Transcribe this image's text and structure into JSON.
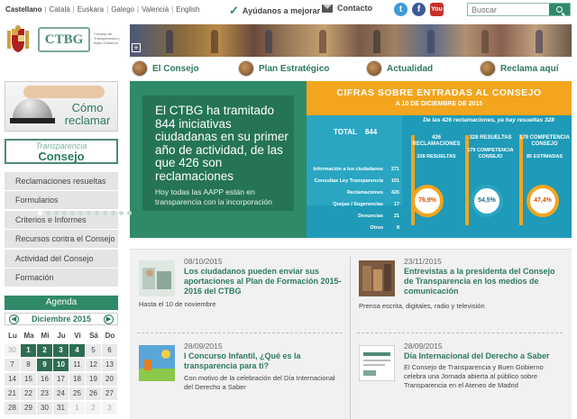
{
  "languages": [
    "Castellano",
    "Català",
    "Euskara",
    "Galego",
    "Valencià",
    "English"
  ],
  "help_link": "Ayúdanos a mejorar",
  "contact_link": "Contacto",
  "social": {
    "twitter": "t",
    "facebook": "f",
    "youtube": "You"
  },
  "search": {
    "placeholder": "Buscar"
  },
  "logo": {
    "name": "CTBG",
    "subtitle": "Consejo de Transparencia y Buen Gobierno"
  },
  "sections": [
    {
      "label": "El Consejo"
    },
    {
      "label": "Plan Estratégico"
    },
    {
      "label": "Actualidad"
    },
    {
      "label": "Reclama aquí"
    }
  ],
  "reclamar_box": "Cómo reclamar",
  "transparencia_box": {
    "line1": "Transparencia",
    "line2": "Consejo"
  },
  "side_menu": [
    "Reclamaciones resueltas",
    "Formularios",
    "Criterios e Informes",
    "Recursos contra el Consejo",
    "Actividad del Consejo",
    "Formación"
  ],
  "agenda": {
    "title": "Agenda",
    "month": "Diciembre 2015",
    "weekdays": [
      "Lu",
      "Ma",
      "Mi",
      "Ju",
      "Vi",
      "Sá",
      "Do"
    ],
    "weeks": [
      [
        "30",
        "1",
        "2",
        "3",
        "4",
        "5",
        "6"
      ],
      [
        "7",
        "8",
        "9",
        "10",
        "11",
        "12",
        "13"
      ],
      [
        "14",
        "15",
        "16",
        "17",
        "18",
        "19",
        "20"
      ],
      [
        "21",
        "22",
        "23",
        "24",
        "25",
        "26",
        "27"
      ],
      [
        "28",
        "29",
        "30",
        "31",
        "1",
        "2",
        "3"
      ]
    ]
  },
  "slider": {
    "headline": "El CTBG ha tramitado 844 iniciativas ciudadanas en su primer año de actividad, de las que 426 son reclamaciones",
    "subtext": "Hoy todas las AAPP están en transparencia con la incorporación"
  },
  "infographic": {
    "title": "CIFRAS SOBRE ENTRADAS AL CONSEJO",
    "date": "A 10 DE DICIEMBRE DE 2015",
    "total_label": "TOTAL",
    "total_value": "844",
    "stats": [
      {
        "label": "Información a los ciudadanos",
        "value": "271"
      },
      {
        "label": "Consultas Ley Transparencia",
        "value": "101"
      },
      {
        "label": "Reclamaciones",
        "value": "426"
      },
      {
        "label": "Quejas / Sugerencias",
        "value": "17"
      },
      {
        "label": "Denuncias",
        "value": "21"
      },
      {
        "label": "Otros",
        "value": "8"
      }
    ],
    "summary_heading": "De las 426 reclamaciones, ya hay resueltas 328",
    "columns": [
      {
        "top": "426 RECLAMACIONES",
        "mid": "328 RESUELTAS"
      },
      {
        "top": "328 RESUELTAS",
        "mid": "179 COMPETENCIA CONSEJO"
      },
      {
        "top": "179 COMPETENCIA CONSEJO",
        "mid": "85 ESTIMADAS"
      }
    ],
    "pies": [
      "76,9%",
      "54,5%",
      "47,4%"
    ]
  },
  "news": [
    {
      "date": "08/10/2015",
      "title": "Los ciudadanos pueden enviar sus aportaciones al Plan de Formación 2015-2016 del CTBG",
      "desc": "Hasta el 10 de noviembre"
    },
    {
      "date": "23/11/2015",
      "title": "Entrevistas a la presidenta del Consejo de Transparencia en los medios de comunicación",
      "desc": "Prensa escrita, digitales, radio y televisión"
    },
    {
      "date": "28/09/2015",
      "title": "I Concurso Infantil, ¿Qué es la transparencia para ti?",
      "desc": "Con motivo de la celebración del Día Internacional del Derecho a Saber"
    },
    {
      "date": "28/09/2015",
      "title": "Día Internacional del Derecho a Saber",
      "desc": "El Consejo de Transparencia y Buen Gobierno celebra una Jornada abierta al público sobre Transparencia en el Ateneo de Madrid"
    }
  ]
}
